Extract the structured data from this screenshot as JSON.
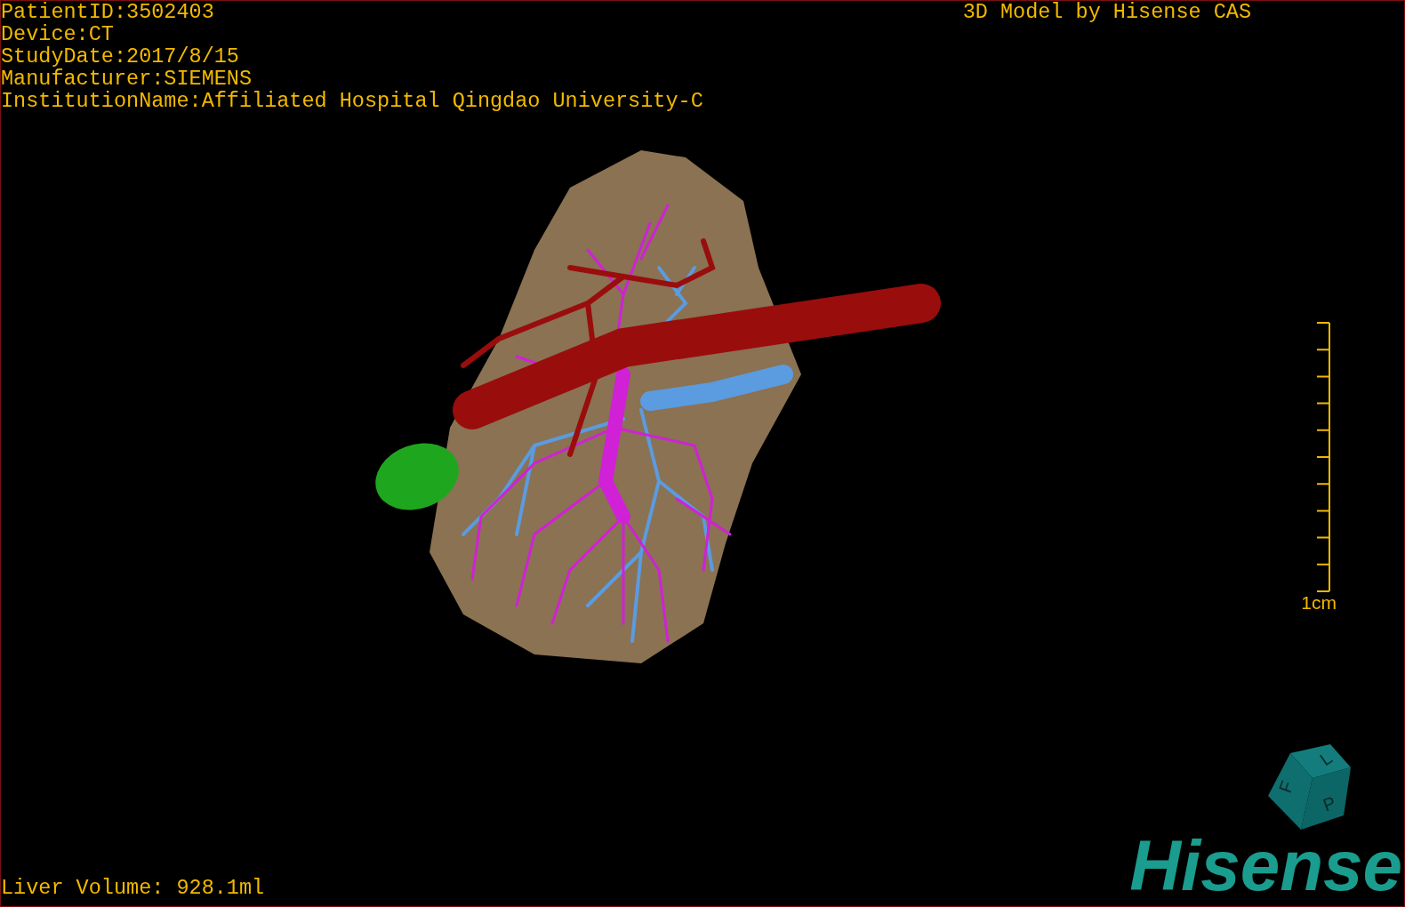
{
  "patient_info": [
    "PatientID:3502403",
    "Device:CT",
    "StudyDate:2017/8/15",
    "Manufacturer:SIEMENS",
    "InstitutionName:Affiliated Hospital Qingdao University-C"
  ],
  "title": "3D Model by Hisense CAS",
  "scale_label": "1cm",
  "liver_volume": "Liver Volume: 928.1ml",
  "orientation_cube": {
    "labels": [
      "F",
      "L",
      "P"
    ]
  },
  "logo": "Hisense"
}
